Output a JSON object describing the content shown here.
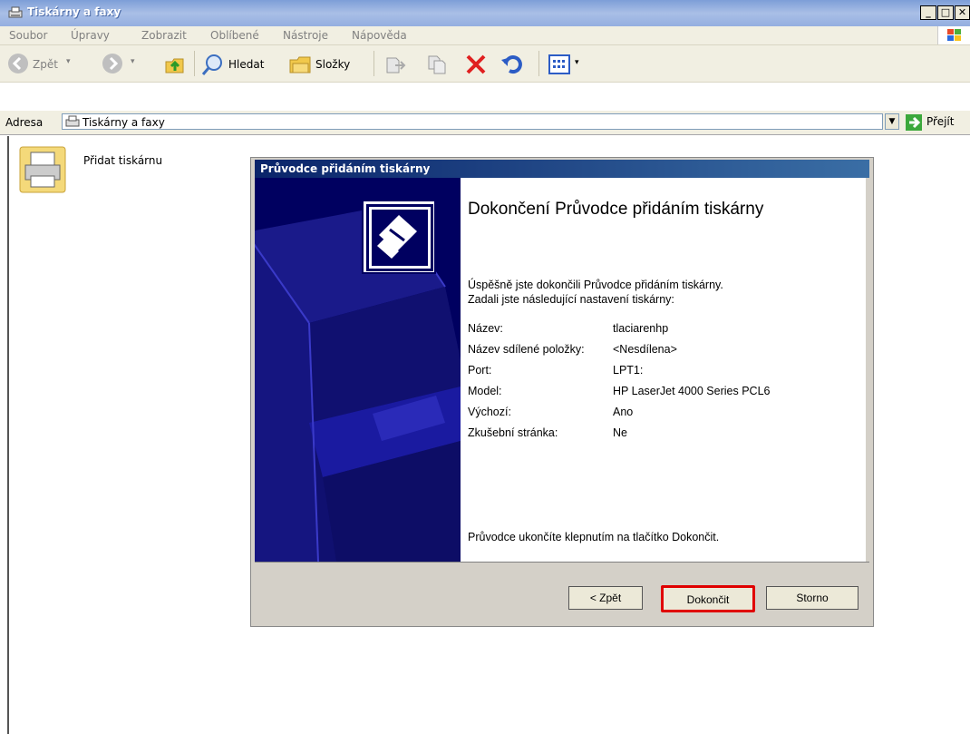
{
  "window": {
    "title": "Tiskárny a faxy"
  },
  "menu": [
    "Soubor",
    "Úpravy",
    "Zobrazit",
    "Oblíbené",
    "Nástroje",
    "Nápověda"
  ],
  "toolbar": {
    "back": "Zpět",
    "search": "Hledat",
    "folders": "Složky"
  },
  "address": {
    "label": "Adresa",
    "value": "Tiskárny a faxy",
    "go": "Přejít"
  },
  "content": {
    "add_printer": "Přidat tiskárnu"
  },
  "wizard": {
    "title": "Průvodce přidáním tiskárny",
    "heading": "Dokončení Průvodce přidáním tiskárny",
    "intro1": "Úspěšně jste dokončili Průvodce přidáním tiskárny.",
    "intro2": "Zadali jste následující nastavení tiskárny:",
    "settings": [
      {
        "label": "Název:",
        "value": "tlaciarenhp"
      },
      {
        "label": "Název sdílené položky:",
        "value": "<Nesdílena>"
      },
      {
        "label": "Port:",
        "value": "LPT1:"
      },
      {
        "label": "Model:",
        "value": "HP LaserJet 4000 Series PCL6"
      },
      {
        "label": "Výchozí:",
        "value": "Ano"
      },
      {
        "label": "Zkušební stránka:",
        "value": "Ne"
      }
    ],
    "footer": "Průvodce ukončíte klepnutím na tlačítko Dokončit.",
    "buttons": {
      "back": "< Zpět",
      "finish": "Dokončit",
      "cancel": "Storno"
    }
  },
  "colors": {
    "highlight": "#e00000",
    "wizard_bg": "#000060",
    "titlebar": "#0a246a"
  }
}
